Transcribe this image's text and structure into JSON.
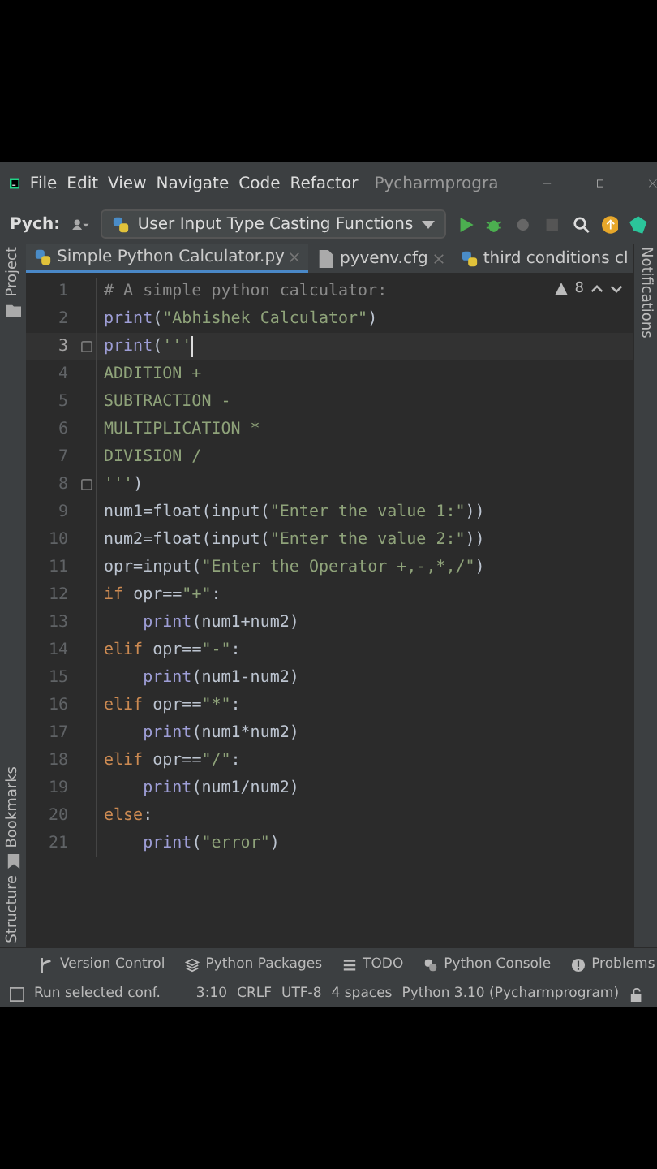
{
  "menu": [
    "File",
    "Edit",
    "View",
    "Navigate",
    "Code",
    "Refactor"
  ],
  "window": {
    "title": "Pycharmprogra"
  },
  "toolbar": {
    "project": "Pych:",
    "run_config": "User Input Type Casting Functions"
  },
  "tabs": [
    {
      "label": "Simple Python Calculator.py",
      "selected": true
    },
    {
      "label": "pyvenv.cfg",
      "selected": false
    },
    {
      "label": "third conditions cl",
      "selected": false
    }
  ],
  "left_tools": [
    "Project",
    "Bookmarks",
    "Structure"
  ],
  "right_tools": [
    "Notifications"
  ],
  "editor": {
    "warnings": "8",
    "lines": [
      {
        "n": "1",
        "current": false,
        "fold": false,
        "tokens": [
          {
            "kind": "comment",
            "text": "# A simple python calculator:"
          }
        ]
      },
      {
        "n": "2",
        "current": false,
        "fold": false,
        "tokens": [
          {
            "kind": "builtin",
            "text": "print"
          },
          {
            "kind": "plain",
            "text": "("
          },
          {
            "kind": "string",
            "text": "\"Abhishek Calculator\""
          },
          {
            "kind": "plain",
            "text": ")"
          }
        ]
      },
      {
        "n": "3",
        "current": true,
        "fold": true,
        "tokens": [
          {
            "kind": "builtin",
            "text": "print"
          },
          {
            "kind": "plain",
            "text": "("
          },
          {
            "kind": "string",
            "text": "'''"
          }
        ]
      },
      {
        "n": "4",
        "current": false,
        "fold": false,
        "tokens": [
          {
            "kind": "string",
            "text": "ADDITION +"
          }
        ]
      },
      {
        "n": "5",
        "current": false,
        "fold": false,
        "tokens": [
          {
            "kind": "string",
            "text": "SUBTRACTION -"
          }
        ]
      },
      {
        "n": "6",
        "current": false,
        "fold": false,
        "tokens": [
          {
            "kind": "string",
            "text": "MULTIPLICATION *"
          }
        ]
      },
      {
        "n": "7",
        "current": false,
        "fold": false,
        "tokens": [
          {
            "kind": "string",
            "text": "DIVISION /"
          }
        ]
      },
      {
        "n": "8",
        "current": false,
        "fold": true,
        "tokens": [
          {
            "kind": "string",
            "text": "'''"
          },
          {
            "kind": "plain",
            "text": ")"
          }
        ]
      },
      {
        "n": "9",
        "current": false,
        "fold": false,
        "tokens": [
          {
            "kind": "plain",
            "text": "num1=float(input("
          },
          {
            "kind": "string",
            "text": "\"Enter the value 1:\""
          },
          {
            "kind": "plain",
            "text": "))"
          }
        ]
      },
      {
        "n": "10",
        "current": false,
        "fold": false,
        "tokens": [
          {
            "kind": "plain",
            "text": "num2=float(input("
          },
          {
            "kind": "string",
            "text": "\"Enter the value 2:\""
          },
          {
            "kind": "plain",
            "text": "))"
          }
        ]
      },
      {
        "n": "11",
        "current": false,
        "fold": false,
        "tokens": [
          {
            "kind": "plain",
            "text": "opr=input("
          },
          {
            "kind": "string",
            "text": "\"Enter the Operator +,-,*,/\""
          },
          {
            "kind": "plain",
            "text": ")"
          }
        ]
      },
      {
        "n": "12",
        "current": false,
        "fold": false,
        "tokens": [
          {
            "kind": "keyword",
            "text": "if"
          },
          {
            "kind": "plain",
            "text": " opr=="
          },
          {
            "kind": "string",
            "text": "\"+\""
          },
          {
            "kind": "plain",
            "text": ":"
          }
        ]
      },
      {
        "n": "13",
        "current": false,
        "fold": false,
        "tokens": [
          {
            "kind": "builtin",
            "text": "    print"
          },
          {
            "kind": "plain",
            "text": "(num1+num2)"
          }
        ]
      },
      {
        "n": "14",
        "current": false,
        "fold": false,
        "tokens": [
          {
            "kind": "keyword",
            "text": "elif"
          },
          {
            "kind": "plain",
            "text": " opr=="
          },
          {
            "kind": "string",
            "text": "\"-\""
          },
          {
            "kind": "plain",
            "text": ":"
          }
        ]
      },
      {
        "n": "15",
        "current": false,
        "fold": false,
        "tokens": [
          {
            "kind": "builtin",
            "text": "    print"
          },
          {
            "kind": "plain",
            "text": "(num1-num2)"
          }
        ]
      },
      {
        "n": "16",
        "current": false,
        "fold": false,
        "tokens": [
          {
            "kind": "keyword",
            "text": "elif"
          },
          {
            "kind": "plain",
            "text": " opr=="
          },
          {
            "kind": "string",
            "text": "\"*\""
          },
          {
            "kind": "plain",
            "text": ":"
          }
        ]
      },
      {
        "n": "17",
        "current": false,
        "fold": false,
        "tokens": [
          {
            "kind": "builtin",
            "text": "    print"
          },
          {
            "kind": "plain",
            "text": "(num1*num2)"
          }
        ]
      },
      {
        "n": "18",
        "current": false,
        "fold": false,
        "tokens": [
          {
            "kind": "keyword",
            "text": "elif"
          },
          {
            "kind": "plain",
            "text": " opr=="
          },
          {
            "kind": "string",
            "text": "\"/\""
          },
          {
            "kind": "plain",
            "text": ":"
          }
        ]
      },
      {
        "n": "19",
        "current": false,
        "fold": false,
        "tokens": [
          {
            "kind": "builtin",
            "text": "    print"
          },
          {
            "kind": "plain",
            "text": "(num1/num2)"
          }
        ]
      },
      {
        "n": "20",
        "current": false,
        "fold": false,
        "tokens": [
          {
            "kind": "keyword",
            "text": "else"
          },
          {
            "kind": "plain",
            "text": ":"
          }
        ]
      },
      {
        "n": "21",
        "current": false,
        "fold": false,
        "tokens": [
          {
            "kind": "builtin",
            "text": "    print"
          },
          {
            "kind": "plain",
            "text": "("
          },
          {
            "kind": "string",
            "text": "\"error\""
          },
          {
            "kind": "plain",
            "text": ")"
          }
        ]
      }
    ]
  },
  "tool_tabs": [
    "Version Control",
    "Python Packages",
    "TODO",
    "Python Console",
    "Problems"
  ],
  "status_bar": [
    "Run selected conf.",
    "3:10",
    "CRLF",
    "UTF-8",
    "4 spaces",
    "Python 3.10 (Pycharmprogram)"
  ]
}
